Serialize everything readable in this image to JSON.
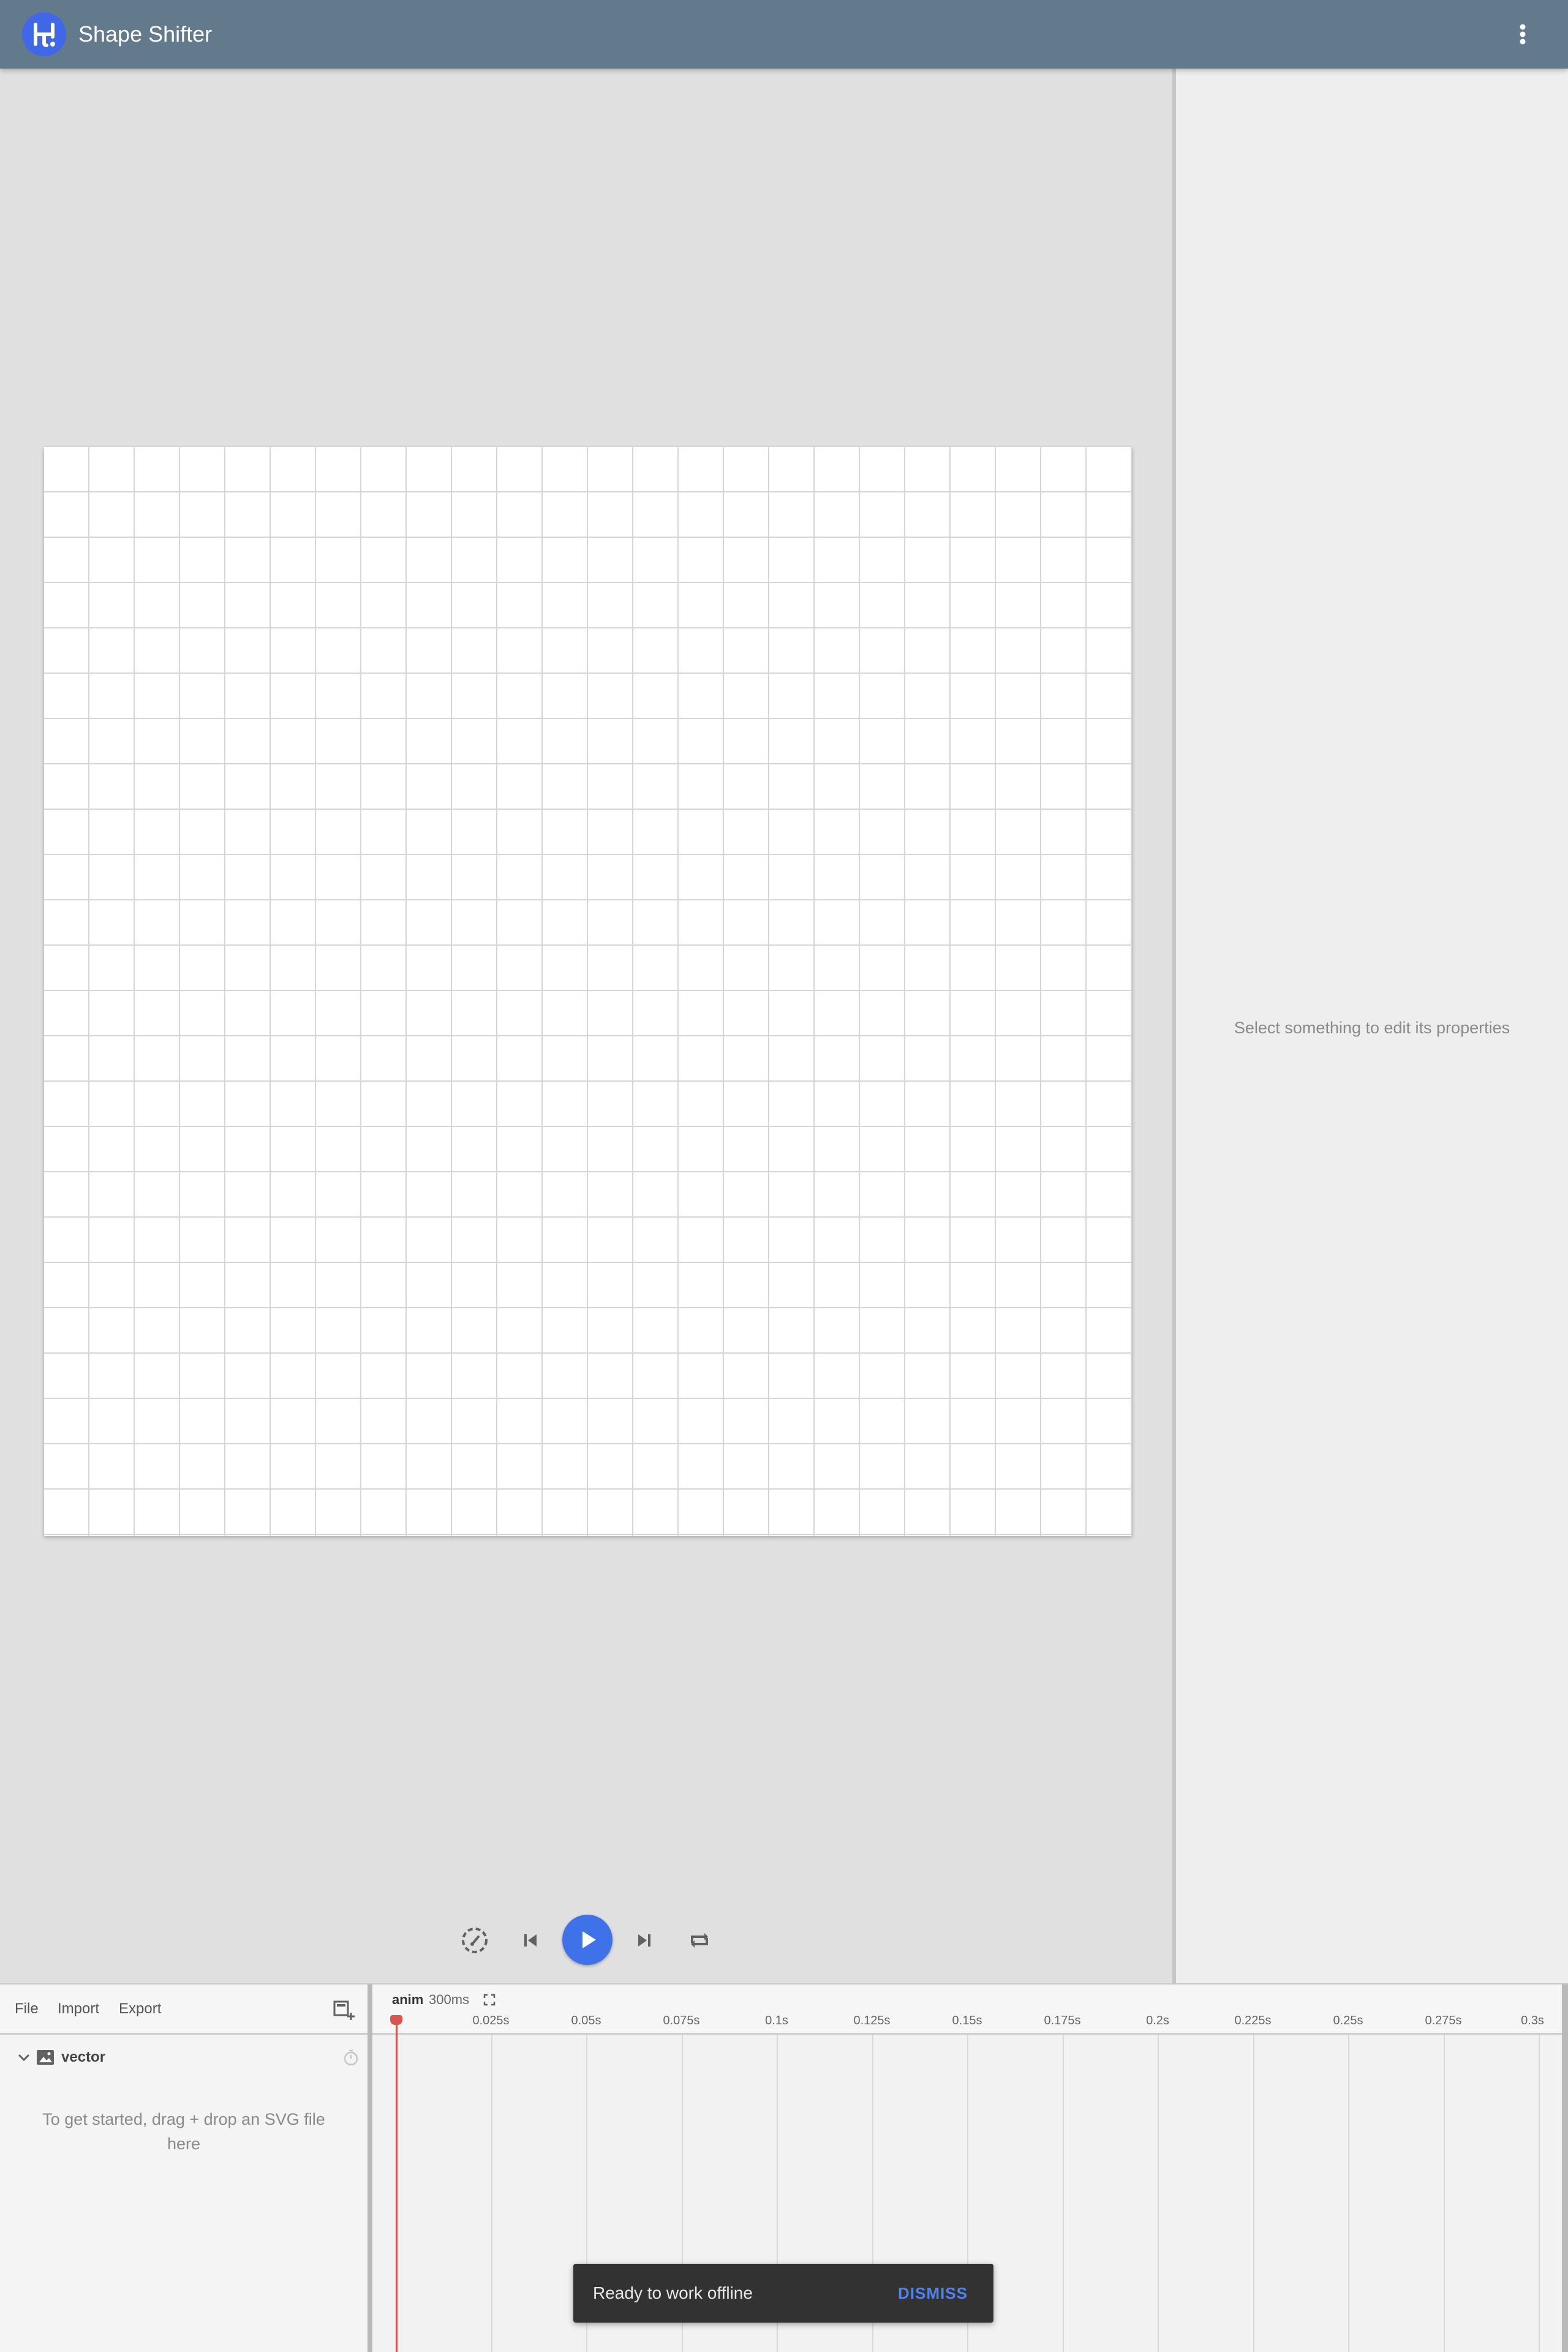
{
  "header": {
    "app_title": "Shape Shifter",
    "logo_icon": "shape-shifter-logo",
    "menu_icon": "more-vert-icon",
    "background": "#637a8c"
  },
  "canvas": {
    "grid": "on"
  },
  "properties": {
    "hint": "Select something to edit its properties"
  },
  "playback": {
    "controls": [
      "playback-speed-icon",
      "skip-previous-icon",
      "play-icon",
      "skip-next-icon",
      "repeat-icon"
    ],
    "accent": "#3f71e8"
  },
  "layers": {
    "menu": {
      "file": "File",
      "import": "Import",
      "export": "Export"
    },
    "items": [
      {
        "name": "vector",
        "icon": "vector-image-icon"
      }
    ],
    "empty_message": "To get started, drag + drop an SVG file here"
  },
  "timeline": {
    "animation_name": "anim",
    "duration": "300ms",
    "ticks": [
      "0.025s",
      "0.05s",
      "0.075s",
      "0.1s",
      "0.125s",
      "0.15s",
      "0.175s",
      "0.2s",
      "0.225s",
      "0.25s",
      "0.275s",
      "0.3s"
    ],
    "playhead_time": "0s",
    "playhead_color": "#d9534f"
  },
  "snackbar": {
    "message": "Ready to work offline",
    "action": "DISMISS"
  }
}
